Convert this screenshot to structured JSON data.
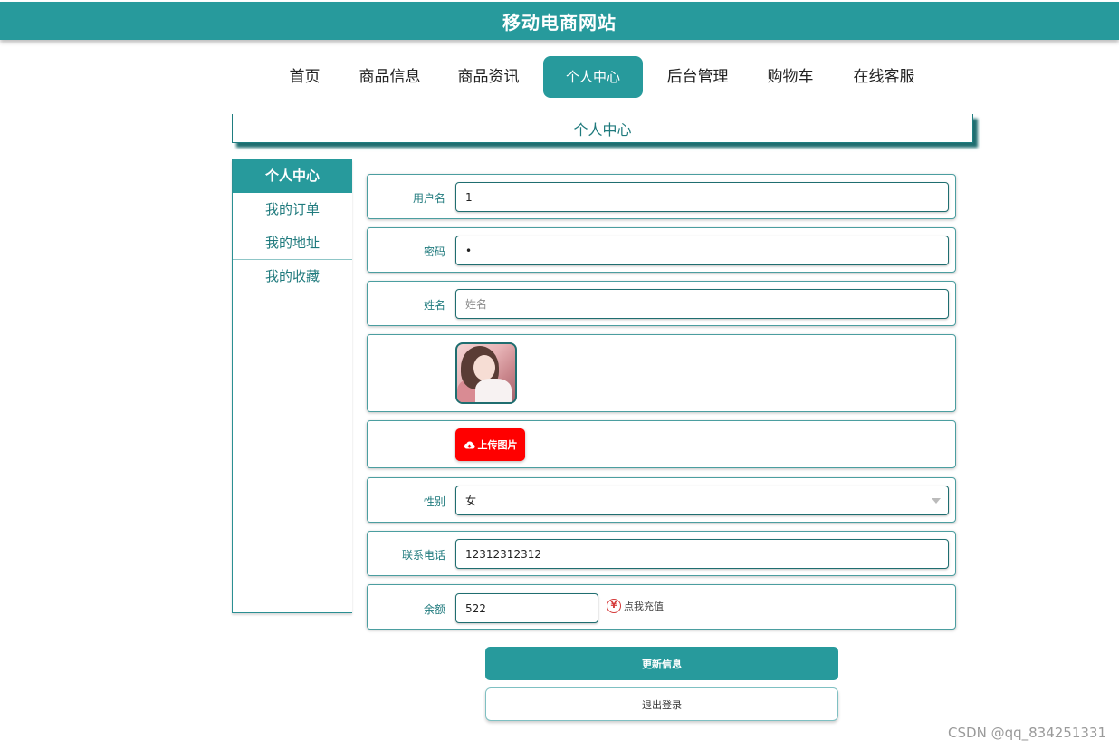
{
  "header": {
    "title": "移动电商网站"
  },
  "nav": {
    "items": [
      {
        "label": "首页"
      },
      {
        "label": "商品信息"
      },
      {
        "label": "商品资讯"
      },
      {
        "label": "个人中心"
      },
      {
        "label": "后台管理"
      },
      {
        "label": "购物车"
      },
      {
        "label": "在线客服"
      }
    ],
    "active": "个人中心"
  },
  "page": {
    "heading": "个人中心"
  },
  "sidebar": {
    "items": [
      {
        "label": "个人中心"
      },
      {
        "label": "我的订单"
      },
      {
        "label": "我的地址"
      },
      {
        "label": "我的收藏"
      }
    ],
    "active": "个人中心"
  },
  "form": {
    "username": {
      "label": "用户名",
      "value": "1"
    },
    "password": {
      "label": "密码",
      "value": "•"
    },
    "name": {
      "label": "姓名",
      "placeholder": "姓名"
    },
    "upload": {
      "label": "上传图片",
      "icon": "cloud-upload-icon"
    },
    "gender": {
      "label": "性别",
      "value": "女"
    },
    "phone": {
      "label": "联系电话",
      "value": "12312312312"
    },
    "balance": {
      "label": "余额",
      "value": "522",
      "recharge_label": "点我充值",
      "recharge_icon": "yen-icon"
    }
  },
  "actions": {
    "update_label": "更新信息",
    "logout_label": "退出登录"
  },
  "watermark": "CSDN @qq_834251331",
  "colors": {
    "accent": "#279a9c",
    "upload": "#ff0000"
  }
}
